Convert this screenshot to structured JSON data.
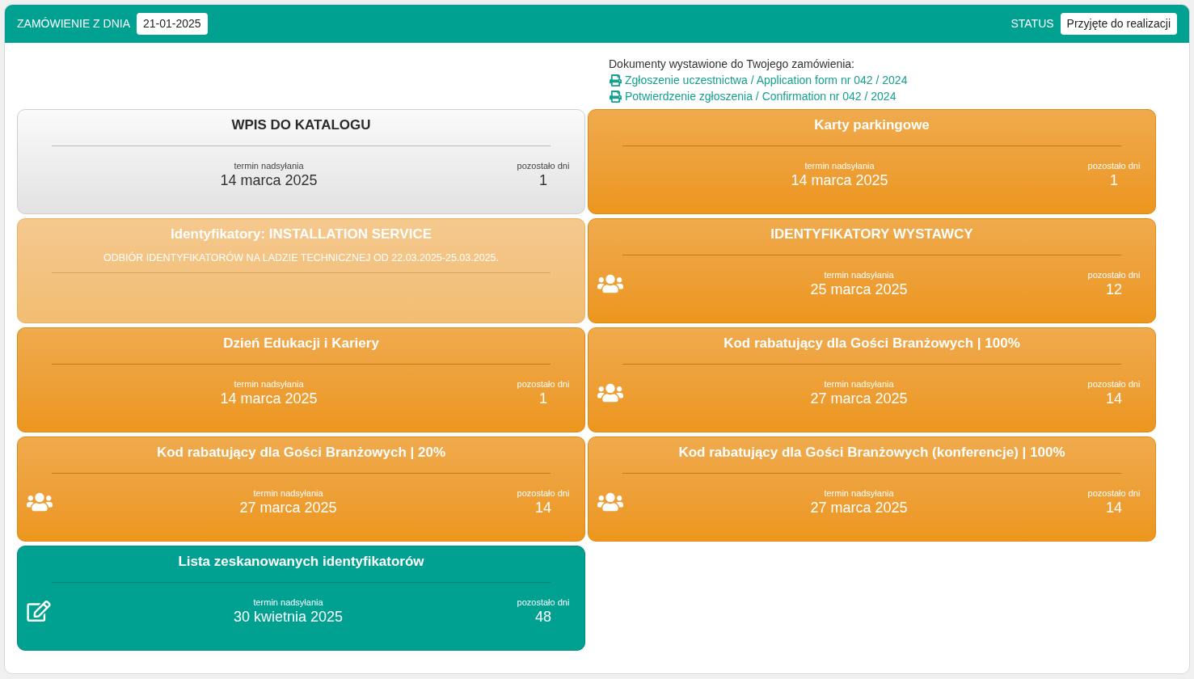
{
  "header": {
    "order_label": "ZAMÓWIENIE Z DNIA",
    "order_date": "21-01-2025",
    "status_label": "STATUS",
    "status_value": "Przyjęte do realizacji"
  },
  "documents": {
    "heading": "Dokumenty wystawione do Twojego zamówienia:",
    "links": [
      "Zgłoszenie uczestnictwa / Application form nr 042 / 2024",
      "Potwierdzenie zgłoszenia / Confirmation nr 042 / 2024"
    ]
  },
  "cards": [
    {
      "kind": "catalog",
      "title": "WPIS DO KATALOGU",
      "deadline_label": "termin nadsyłania",
      "deadline": "14 marca 2025",
      "days_label": "pozostało dni",
      "days": "1"
    },
    {
      "kind": "task",
      "title": "Karty parkingowe",
      "deadline_label": "termin nadsyłania",
      "deadline": "14 marca 2025",
      "days_label": "pozostało dni",
      "days": "1"
    },
    {
      "kind": "info",
      "title": "Identyfikatory: INSTALLATION SERVICE",
      "note": "ODBIÓR IDENTYFIKATORÓW NA LADZIE TECHNICZNEJ OD 22.03.2025-25.03.2025."
    },
    {
      "kind": "group",
      "title": "IDENTYFIKATORY WYSTAWCY",
      "deadline_label": "termin nadsyłania",
      "deadline": "25 marca 2025",
      "days_label": "pozostało dni",
      "days": "12"
    },
    {
      "kind": "task",
      "title": "Dzień Edukacji i Kariery",
      "deadline_label": "termin nadsyłania",
      "deadline": "14 marca 2025",
      "days_label": "pozostało dni",
      "days": "1"
    },
    {
      "kind": "group",
      "title": "Kod rabatujący dla Gości Branżowych | 100%",
      "deadline_label": "termin nadsyłania",
      "deadline": "27 marca 2025",
      "days_label": "pozostało dni",
      "days": "14"
    },
    {
      "kind": "group",
      "title": "Kod rabatujący dla Gości Branżowych | 20%",
      "deadline_label": "termin nadsyłania",
      "deadline": "27 marca 2025",
      "days_label": "pozostało dni",
      "days": "14"
    },
    {
      "kind": "group",
      "title": "Kod rabatujący dla Gości Branżowych (konferencje) | 100%",
      "deadline_label": "termin nadsyłania",
      "deadline": "27 marca 2025",
      "days_label": "pozostało dni",
      "days": "14"
    },
    {
      "kind": "scan",
      "title": "Lista zeskanowanych identyfikatorów",
      "deadline_label": "termin nadsyłania",
      "deadline": "30 kwietnia 2025",
      "days_label": "pozostało dni",
      "days": "48"
    }
  ]
}
